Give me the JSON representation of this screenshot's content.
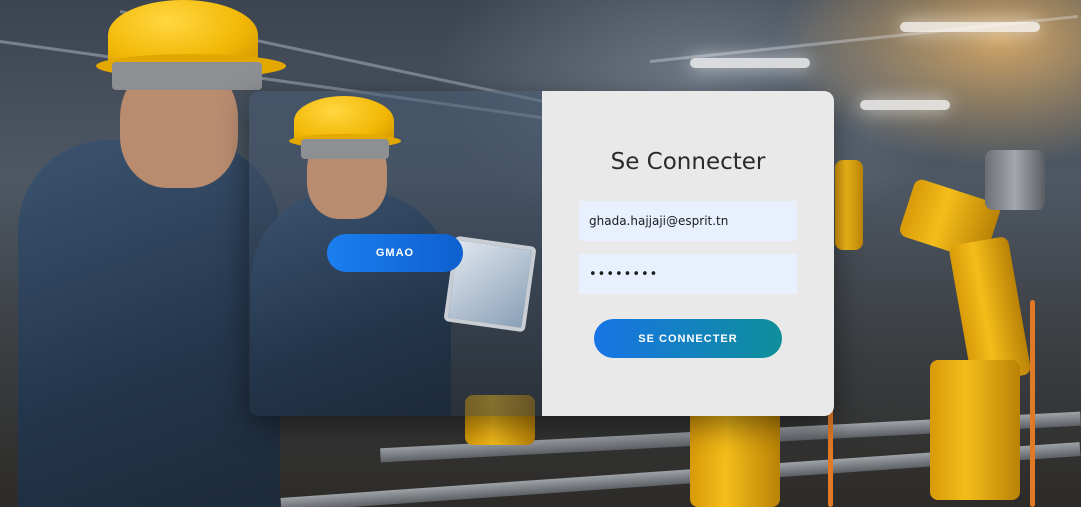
{
  "colors": {
    "primary": "#1a7ff0",
    "accent_teal": "#0f8f9a",
    "card_bg": "#e9e9ea",
    "input_bg": "#e8f0fe"
  },
  "background": {
    "icon": "factory-photo"
  },
  "left_panel": {
    "gmao_label": "GMAO"
  },
  "login": {
    "title": "Se Connecter",
    "email_value": "ghada.hajjaji@esprit.tn",
    "password_value": "••••••••",
    "submit_label": "SE CONNECTER"
  }
}
